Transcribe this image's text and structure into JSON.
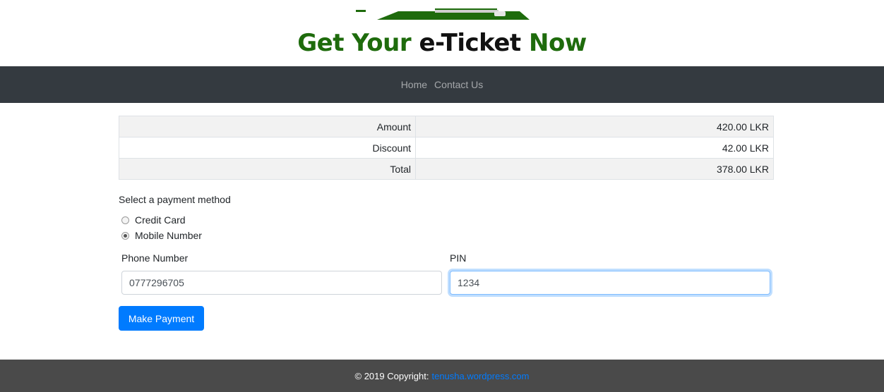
{
  "header": {
    "title_part1": "Get Your ",
    "title_part2": "e-Ticket",
    "title_part3": " Now",
    "title_green": "#1e6b0c"
  },
  "navbar": {
    "items": [
      {
        "label": "Home"
      },
      {
        "label": "Contact Us"
      }
    ]
  },
  "summary": {
    "rows": [
      {
        "label": "Amount",
        "value": "420.00 LKR"
      },
      {
        "label": "Discount",
        "value": "42.00 LKR"
      },
      {
        "label": "Total",
        "value": "378.00 LKR"
      }
    ]
  },
  "payment": {
    "prompt": "Select a payment method",
    "options": [
      {
        "label": "Credit Card",
        "selected": false
      },
      {
        "label": "Mobile Number",
        "selected": true
      }
    ],
    "phone_label": "Phone Number",
    "phone_value": "0777296705",
    "pin_label": "PIN",
    "pin_value": "1234",
    "submit_label": "Make Payment",
    "accent": "#007bff"
  },
  "footer": {
    "copyright": "© 2019 Copyright:",
    "link_text": "tenusha.wordpress.com"
  }
}
